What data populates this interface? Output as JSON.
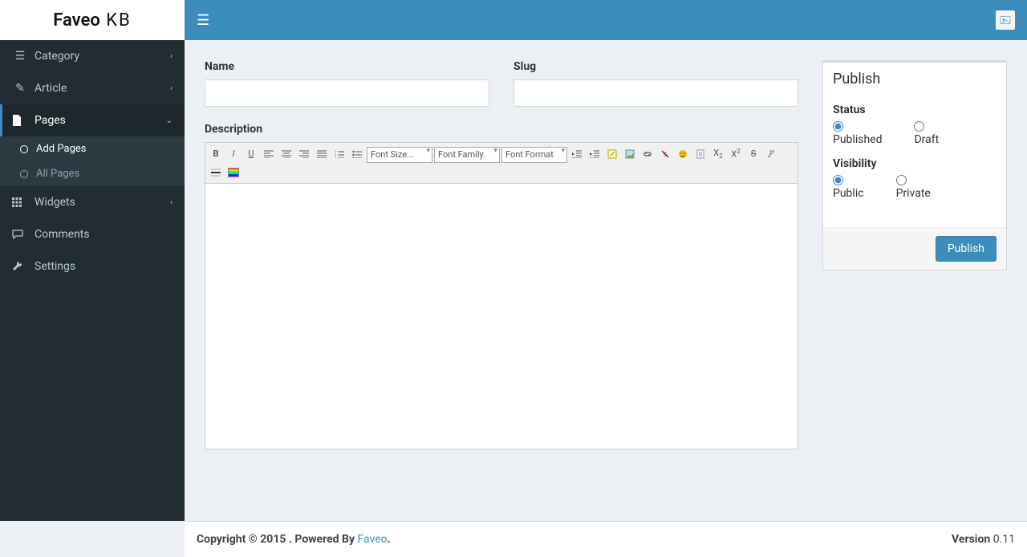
{
  "brand": {
    "main": "Faveo",
    "suffix": " KB"
  },
  "sidebar": {
    "items": [
      {
        "label": "Category",
        "icon": "list"
      },
      {
        "label": "Article",
        "icon": "edit"
      },
      {
        "label": "Pages",
        "icon": "file",
        "expanded": true,
        "children": [
          {
            "label": "Add Pages",
            "active": true
          },
          {
            "label": "All Pages"
          }
        ]
      },
      {
        "label": "Widgets",
        "icon": "grid"
      },
      {
        "label": "Comments",
        "icon": "comment"
      },
      {
        "label": "Settings",
        "icon": "wrench"
      }
    ]
  },
  "form": {
    "name_label": "Name",
    "name_value": "",
    "slug_label": "Slug",
    "slug_value": "",
    "desc_label": "Description",
    "toolbar": {
      "font_size": "Font Size...",
      "font_family": "Font Family.",
      "font_format": "Font Format"
    }
  },
  "publish": {
    "title": "Publish",
    "status_label": "Status",
    "status_opts": {
      "published": "Published",
      "draft": "Draft"
    },
    "status_value": "published",
    "vis_label": "Visibility",
    "vis_opts": {
      "public": "Public",
      "private": "Private"
    },
    "vis_value": "public",
    "button": "Publish"
  },
  "footer": {
    "copyright": "Copyright © 2015 . Powered By ",
    "link": "Faveo",
    "dot": ".",
    "version_label": "Version",
    "version_num": " 0.11"
  }
}
